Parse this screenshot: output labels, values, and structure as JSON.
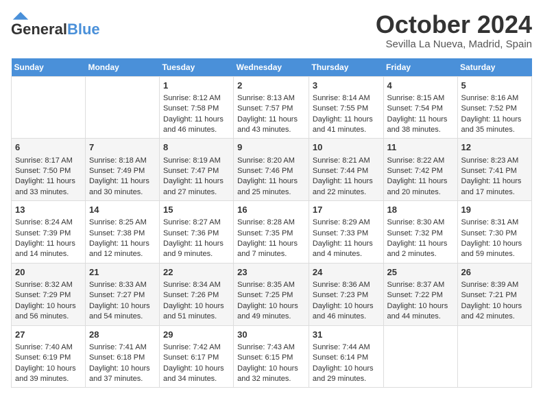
{
  "header": {
    "logo_general": "General",
    "logo_blue": "Blue",
    "title": "October 2024",
    "location": "Sevilla La Nueva, Madrid, Spain"
  },
  "days_of_week": [
    "Sunday",
    "Monday",
    "Tuesday",
    "Wednesday",
    "Thursday",
    "Friday",
    "Saturday"
  ],
  "weeks": [
    [
      {
        "day": "",
        "empty": true
      },
      {
        "day": "",
        "empty": true
      },
      {
        "day": "1",
        "sunrise": "Sunrise: 8:12 AM",
        "sunset": "Sunset: 7:58 PM",
        "daylight": "Daylight: 11 hours and 46 minutes."
      },
      {
        "day": "2",
        "sunrise": "Sunrise: 8:13 AM",
        "sunset": "Sunset: 7:57 PM",
        "daylight": "Daylight: 11 hours and 43 minutes."
      },
      {
        "day": "3",
        "sunrise": "Sunrise: 8:14 AM",
        "sunset": "Sunset: 7:55 PM",
        "daylight": "Daylight: 11 hours and 41 minutes."
      },
      {
        "day": "4",
        "sunrise": "Sunrise: 8:15 AM",
        "sunset": "Sunset: 7:54 PM",
        "daylight": "Daylight: 11 hours and 38 minutes."
      },
      {
        "day": "5",
        "sunrise": "Sunrise: 8:16 AM",
        "sunset": "Sunset: 7:52 PM",
        "daylight": "Daylight: 11 hours and 35 minutes."
      }
    ],
    [
      {
        "day": "6",
        "sunrise": "Sunrise: 8:17 AM",
        "sunset": "Sunset: 7:50 PM",
        "daylight": "Daylight: 11 hours and 33 minutes."
      },
      {
        "day": "7",
        "sunrise": "Sunrise: 8:18 AM",
        "sunset": "Sunset: 7:49 PM",
        "daylight": "Daylight: 11 hours and 30 minutes."
      },
      {
        "day": "8",
        "sunrise": "Sunrise: 8:19 AM",
        "sunset": "Sunset: 7:47 PM",
        "daylight": "Daylight: 11 hours and 27 minutes."
      },
      {
        "day": "9",
        "sunrise": "Sunrise: 8:20 AM",
        "sunset": "Sunset: 7:46 PM",
        "daylight": "Daylight: 11 hours and 25 minutes."
      },
      {
        "day": "10",
        "sunrise": "Sunrise: 8:21 AM",
        "sunset": "Sunset: 7:44 PM",
        "daylight": "Daylight: 11 hours and 22 minutes."
      },
      {
        "day": "11",
        "sunrise": "Sunrise: 8:22 AM",
        "sunset": "Sunset: 7:42 PM",
        "daylight": "Daylight: 11 hours and 20 minutes."
      },
      {
        "day": "12",
        "sunrise": "Sunrise: 8:23 AM",
        "sunset": "Sunset: 7:41 PM",
        "daylight": "Daylight: 11 hours and 17 minutes."
      }
    ],
    [
      {
        "day": "13",
        "sunrise": "Sunrise: 8:24 AM",
        "sunset": "Sunset: 7:39 PM",
        "daylight": "Daylight: 11 hours and 14 minutes."
      },
      {
        "day": "14",
        "sunrise": "Sunrise: 8:25 AM",
        "sunset": "Sunset: 7:38 PM",
        "daylight": "Daylight: 11 hours and 12 minutes."
      },
      {
        "day": "15",
        "sunrise": "Sunrise: 8:27 AM",
        "sunset": "Sunset: 7:36 PM",
        "daylight": "Daylight: 11 hours and 9 minutes."
      },
      {
        "day": "16",
        "sunrise": "Sunrise: 8:28 AM",
        "sunset": "Sunset: 7:35 PM",
        "daylight": "Daylight: 11 hours and 7 minutes."
      },
      {
        "day": "17",
        "sunrise": "Sunrise: 8:29 AM",
        "sunset": "Sunset: 7:33 PM",
        "daylight": "Daylight: 11 hours and 4 minutes."
      },
      {
        "day": "18",
        "sunrise": "Sunrise: 8:30 AM",
        "sunset": "Sunset: 7:32 PM",
        "daylight": "Daylight: 11 hours and 2 minutes."
      },
      {
        "day": "19",
        "sunrise": "Sunrise: 8:31 AM",
        "sunset": "Sunset: 7:30 PM",
        "daylight": "Daylight: 10 hours and 59 minutes."
      }
    ],
    [
      {
        "day": "20",
        "sunrise": "Sunrise: 8:32 AM",
        "sunset": "Sunset: 7:29 PM",
        "daylight": "Daylight: 10 hours and 56 minutes."
      },
      {
        "day": "21",
        "sunrise": "Sunrise: 8:33 AM",
        "sunset": "Sunset: 7:27 PM",
        "daylight": "Daylight: 10 hours and 54 minutes."
      },
      {
        "day": "22",
        "sunrise": "Sunrise: 8:34 AM",
        "sunset": "Sunset: 7:26 PM",
        "daylight": "Daylight: 10 hours and 51 minutes."
      },
      {
        "day": "23",
        "sunrise": "Sunrise: 8:35 AM",
        "sunset": "Sunset: 7:25 PM",
        "daylight": "Daylight: 10 hours and 49 minutes."
      },
      {
        "day": "24",
        "sunrise": "Sunrise: 8:36 AM",
        "sunset": "Sunset: 7:23 PM",
        "daylight": "Daylight: 10 hours and 46 minutes."
      },
      {
        "day": "25",
        "sunrise": "Sunrise: 8:37 AM",
        "sunset": "Sunset: 7:22 PM",
        "daylight": "Daylight: 10 hours and 44 minutes."
      },
      {
        "day": "26",
        "sunrise": "Sunrise: 8:39 AM",
        "sunset": "Sunset: 7:21 PM",
        "daylight": "Daylight: 10 hours and 42 minutes."
      }
    ],
    [
      {
        "day": "27",
        "sunrise": "Sunrise: 7:40 AM",
        "sunset": "Sunset: 6:19 PM",
        "daylight": "Daylight: 10 hours and 39 minutes."
      },
      {
        "day": "28",
        "sunrise": "Sunrise: 7:41 AM",
        "sunset": "Sunset: 6:18 PM",
        "daylight": "Daylight: 10 hours and 37 minutes."
      },
      {
        "day": "29",
        "sunrise": "Sunrise: 7:42 AM",
        "sunset": "Sunset: 6:17 PM",
        "daylight": "Daylight: 10 hours and 34 minutes."
      },
      {
        "day": "30",
        "sunrise": "Sunrise: 7:43 AM",
        "sunset": "Sunset: 6:15 PM",
        "daylight": "Daylight: 10 hours and 32 minutes."
      },
      {
        "day": "31",
        "sunrise": "Sunrise: 7:44 AM",
        "sunset": "Sunset: 6:14 PM",
        "daylight": "Daylight: 10 hours and 29 minutes."
      },
      {
        "day": "",
        "empty": true
      },
      {
        "day": "",
        "empty": true
      }
    ]
  ]
}
